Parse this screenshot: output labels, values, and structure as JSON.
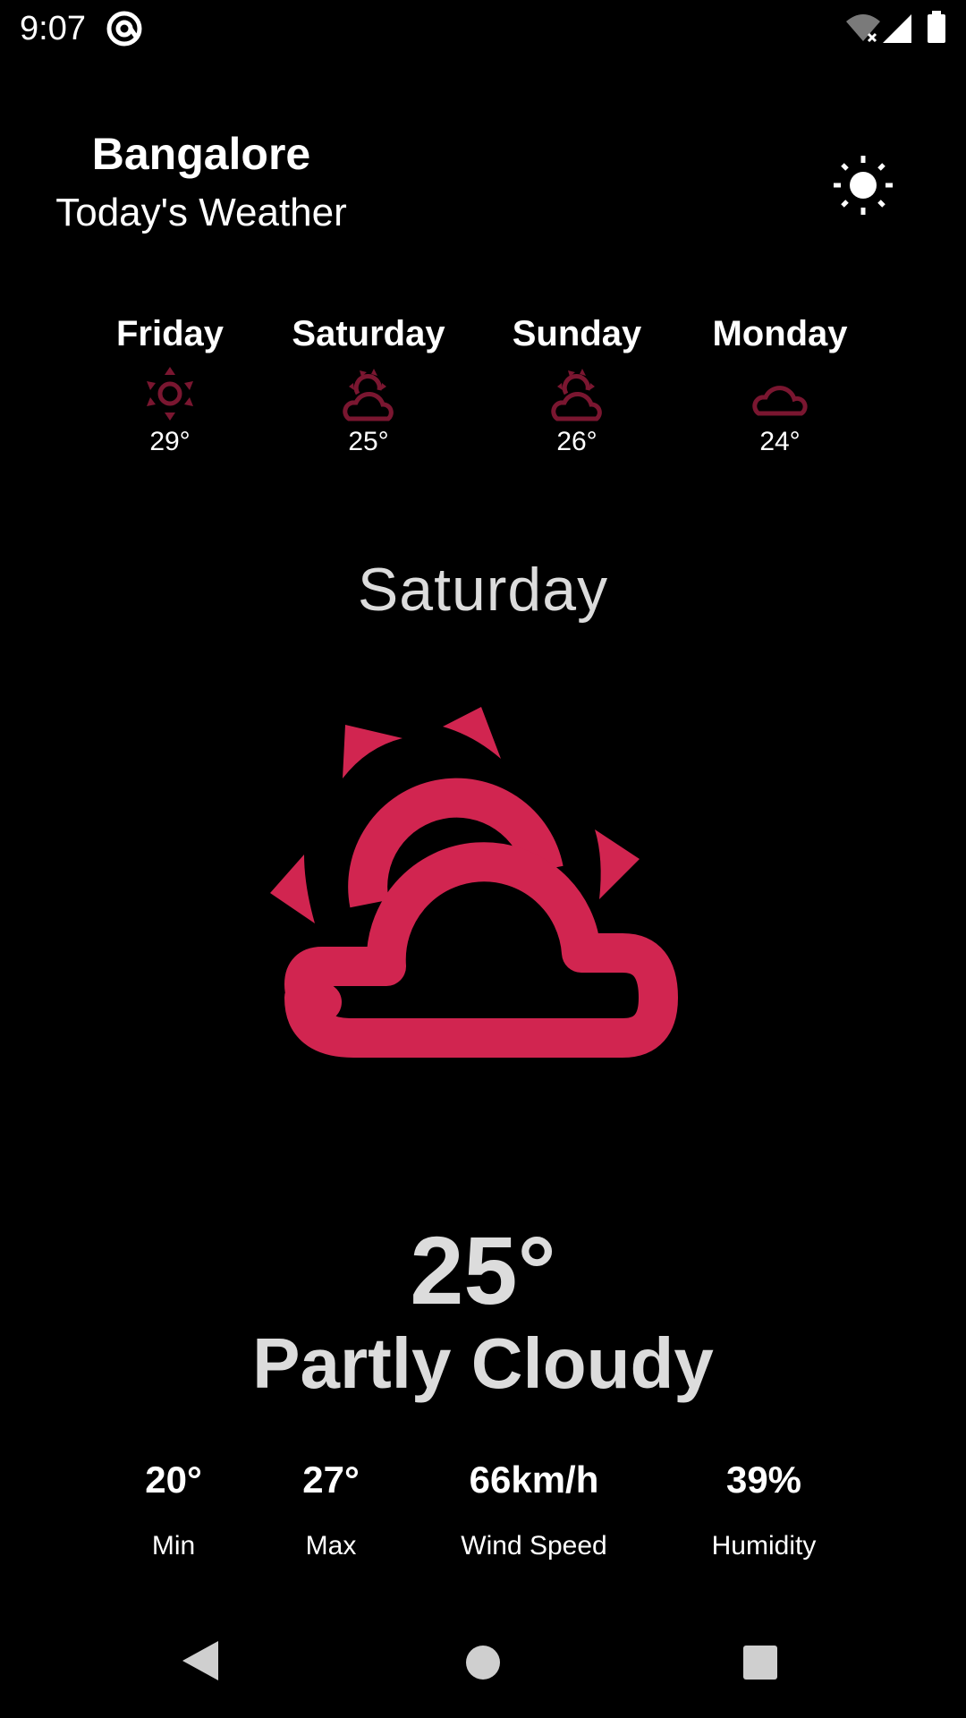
{
  "status_bar": {
    "time": "9:07"
  },
  "header": {
    "city": "Bangalore",
    "subtitle": "Today's Weather",
    "theme_icon": "sun-icon"
  },
  "forecast": [
    {
      "day": "Friday",
      "temp": "29°",
      "icon": "sun-icon"
    },
    {
      "day": "Saturday",
      "temp": "25°",
      "icon": "partly-cloudy-icon"
    },
    {
      "day": "Sunday",
      "temp": "26°",
      "icon": "partly-cloudy-icon"
    },
    {
      "day": "Monday",
      "temp": "24°",
      "icon": "cloud-icon"
    }
  ],
  "selected": {
    "day": "Saturday",
    "temp": "25°",
    "condition": "Partly Cloudy",
    "icon": "partly-cloudy-icon"
  },
  "stats": [
    {
      "value": "20°",
      "label": "Min"
    },
    {
      "value": "27°",
      "label": "Max"
    },
    {
      "value": "66km/h",
      "label": "Wind Speed"
    },
    {
      "value": "39%",
      "label": "Humidity"
    }
  ],
  "colors": {
    "accent": "#d12550",
    "forecast_icon": "#7a1630",
    "background": "#000000",
    "text_muted": "#dcdcdc"
  }
}
